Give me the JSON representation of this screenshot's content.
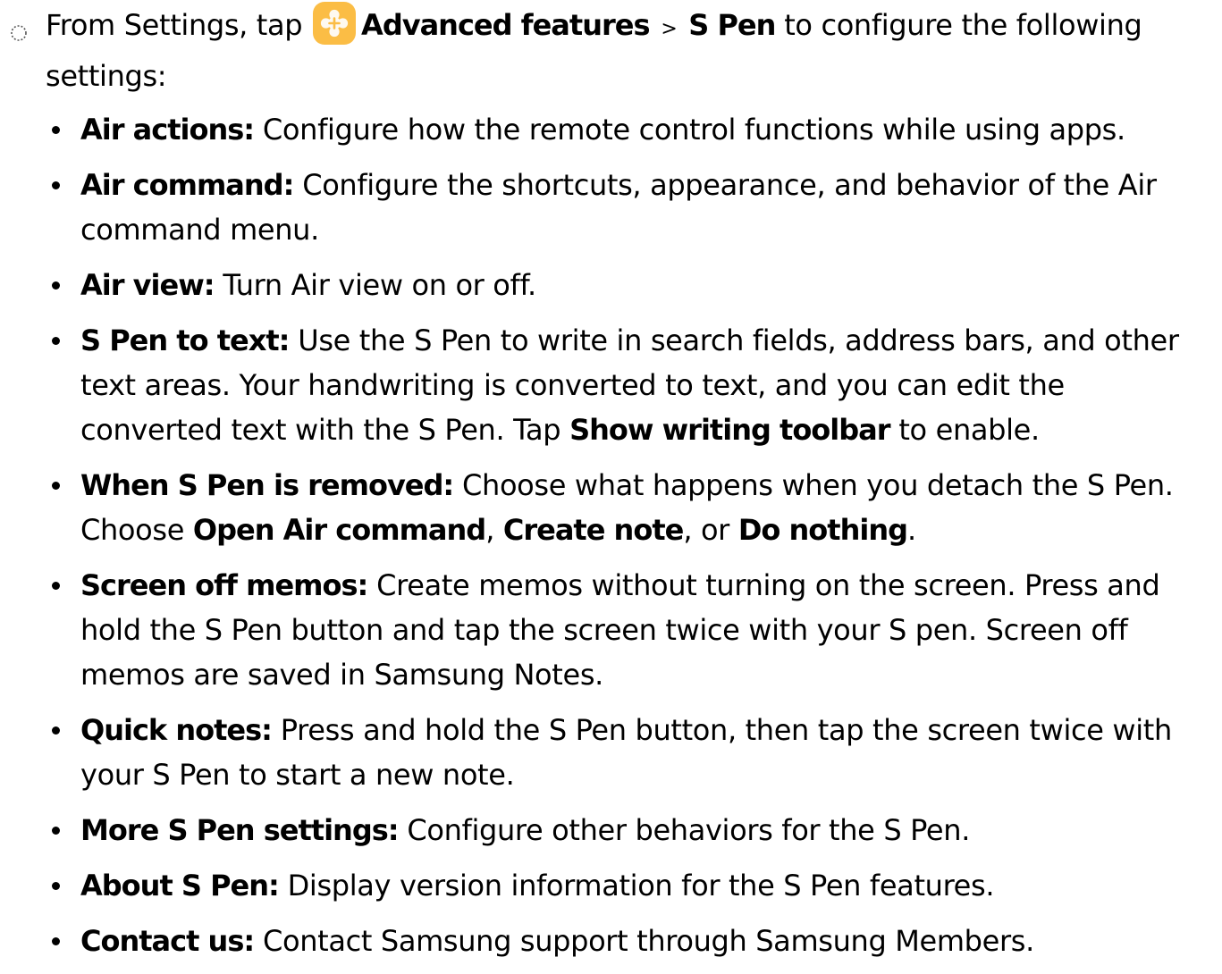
{
  "intro": {
    "prefix": "From Settings, tap",
    "menu": "Advanced features",
    "separator": ">",
    "submenu": "S Pen",
    "suffix": "to configure the following settings:",
    "icon": "advanced-features-icon",
    "icon_color": "#FBBD45"
  },
  "items": [
    {
      "term": "Air actions:",
      "desc": "Configure how the remote control functions while using apps."
    },
    {
      "term": "Air command:",
      "desc": "Configure the shortcuts, appearance, and behavior of the Air command menu."
    },
    {
      "term": "Air view:",
      "desc": "Turn Air view on or off."
    },
    {
      "term": "S Pen to text:",
      "desc": "Use the S Pen to write in search fields, address bars, and other text areas. Your handwriting is converted to text, and you can edit the converted text with the S Pen. Tap",
      "em1": "Show writing toolbar",
      "tail": "to enable."
    },
    {
      "term": "When S Pen is removed:",
      "desc": "Choose what happens when you detach the S Pen. Choose",
      "em1": "Open Air command",
      "mid": ",",
      "em2": "Create note",
      "mid2": ", or",
      "em3": "Do nothing",
      "tail": "."
    },
    {
      "term": "Screen off memos:",
      "desc": "Create memos without turning on the screen. Press and hold the S Pen button and tap the screen twice with your S pen. Screen off memos are saved in Samsung Notes."
    },
    {
      "term": "Quick notes:",
      "desc": "Press and hold the S Pen button, then tap the screen twice with your S Pen to start a new note."
    },
    {
      "term": "More S Pen settings:",
      "desc": "Configure other behaviors for the S Pen."
    },
    {
      "term": "About S Pen:",
      "desc": "Display version information for the S Pen features."
    },
    {
      "term": "Contact us:",
      "desc": "Contact Samsung support through Samsung Members."
    }
  ]
}
